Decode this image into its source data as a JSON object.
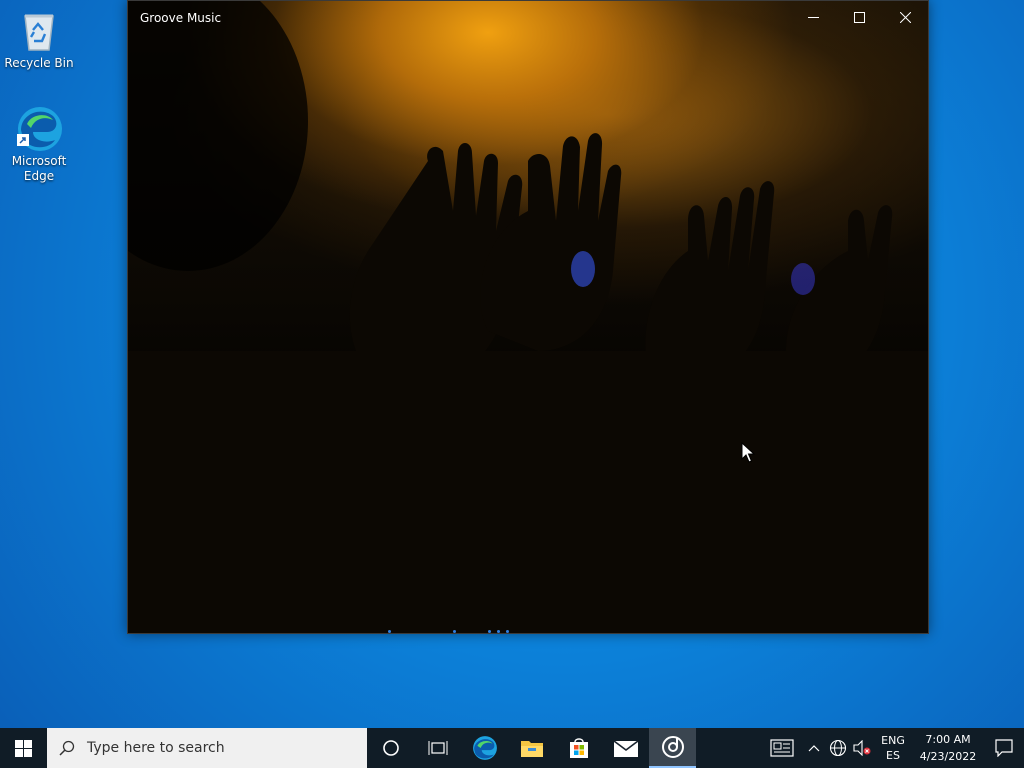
{
  "desktop": {
    "icons": [
      {
        "label": "Recycle Bin",
        "icon": "recycle-bin-icon"
      },
      {
        "label": "Microsoft\nEdge",
        "icon": "edge-icon"
      }
    ]
  },
  "window": {
    "title": "Groove Music",
    "buttons": {
      "minimize": "minimize-icon",
      "maximize": "maximize-icon",
      "close": "close-icon"
    },
    "accent": "#2f7fe0"
  },
  "taskbar": {
    "search_placeholder": "Type here to search",
    "apps": [
      "cortana",
      "task-view",
      "edge",
      "file-explorer",
      "microsoft-store",
      "mail",
      "groove-music"
    ],
    "language": {
      "line1": "ENG",
      "line2": "ES"
    },
    "clock": {
      "time": "7:00 AM",
      "date": "4/23/2022"
    },
    "background": "#101c26"
  }
}
